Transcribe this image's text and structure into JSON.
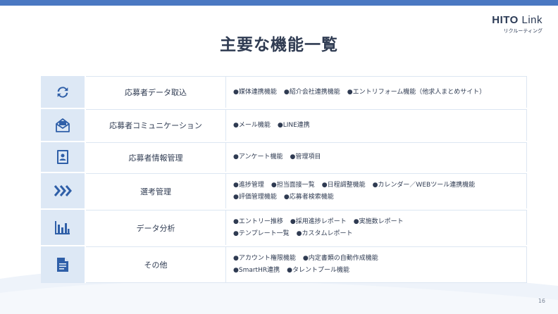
{
  "logo": {
    "main_bold": "HITO",
    "main_rest": " Link",
    "sub": "リクルーティング"
  },
  "title": "主要な機能一覧",
  "colors": {
    "accent": "#4a78c2",
    "icon": "#2f5fa8",
    "icon_bg": "#dde8f5"
  },
  "rows": [
    {
      "icon": "sync-icon",
      "label": "応募者データ取込",
      "lines": [
        [
          "●媒体連携機能",
          "●紹介会社連携機能",
          "●エントリフォーム機能（他求人まとめサイト）"
        ]
      ]
    },
    {
      "icon": "mail-icon",
      "label": "応募者コミュニケーション",
      "lines": [
        [
          "●メール機能",
          "●LINE連携"
        ]
      ]
    },
    {
      "icon": "contact-book-icon",
      "label": "応募者情報管理",
      "lines": [
        [
          "●アンケート機能",
          "●管理項目"
        ]
      ]
    },
    {
      "icon": "chevrons-right-icon",
      "label": "選考管理",
      "lines": [
        [
          "●進捗管理",
          "●担当面接一覧",
          "●日程調整機能",
          "●カレンダー／WEBツール連携機能"
        ],
        [
          "●評価管理機能",
          "●応募者検索機能"
        ]
      ]
    },
    {
      "icon": "bar-chart-icon",
      "label": "データ分析",
      "lines": [
        [
          "●エントリー推移",
          "●採用進捗レポート",
          "●実施数レポート"
        ],
        [
          "●テンプレート一覧",
          "●カスタムレポート"
        ]
      ]
    },
    {
      "icon": "document-icon",
      "label": "その他",
      "lines": [
        [
          "●アカウント権限機能",
          "●内定書類の自動作成機能"
        ],
        [
          "●SmartHR連携",
          "●タレントプール機能"
        ]
      ]
    }
  ],
  "page_number": "16"
}
